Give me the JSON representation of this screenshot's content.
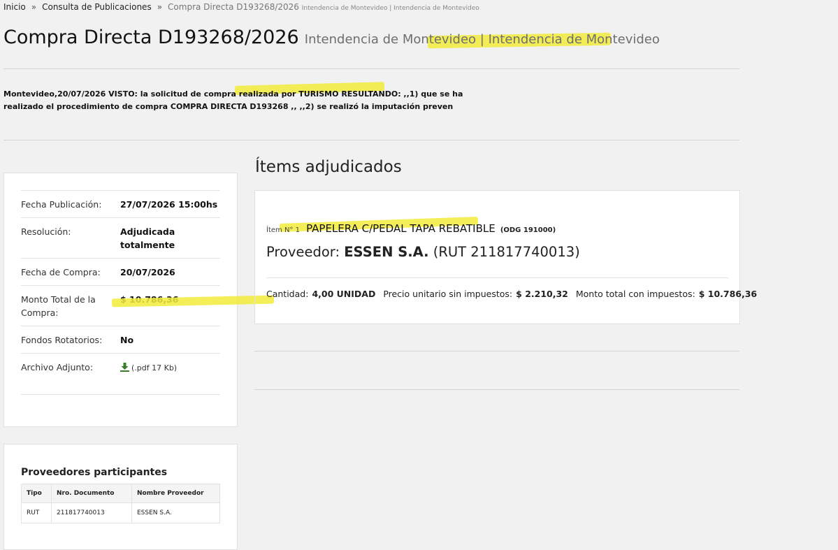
{
  "breadcrumb": {
    "home": "Inicio",
    "sep": "»",
    "section": "Consulta de Publicaciones",
    "current": "Compra Directa D193268/2026",
    "current_sub": "Intendencia de Montevideo | Intendencia de Montevideo"
  },
  "header": {
    "title": "Compra Directa D193268/2026",
    "subtitle": "Intendencia de Montevideo | Intendencia de Montevideo"
  },
  "summary": {
    "visto_text": "Montevideo,20/07/2026 VISTO: la solicitud de compra realizada por TURISMO RESULTANDO: ,,1) que se ha realizado el procedimiento de compra COMPRA DIRECTA D193268 ,, ,,2) se realizó la imputación preven"
  },
  "details": {
    "fecha_publicacion_label": "Fecha Publicación:",
    "fecha_publicacion_value": "27/07/2026 15:00hs",
    "resolucion_label": "Resolución:",
    "resolucion_value": "Adjudicada totalmente",
    "fecha_compra_label": "Fecha de Compra:",
    "fecha_compra_value": "20/07/2026",
    "monto_total_label": "Monto Total de la Compra:",
    "monto_total_value": "$ 10.786,36",
    "fondos_label": "Fondos Rotatorios:",
    "fondos_value": "No",
    "archivo_label": "Archivo Adjunto:",
    "archivo_value": "(.pdf 17 Kb)",
    "archivo_icon": "download-icon"
  },
  "items": {
    "title": "Ítems adjudicados",
    "item_number": "Ítem N° 1",
    "item_name": "PAPELERA C/PEDAL TAPA REBATIBLE",
    "item_code": "(ODG 191000)",
    "provider_label": "Proveedor:",
    "provider_name": "ESSEN S.A.",
    "provider_rut": "(RUT 211817740013)",
    "cantidad_label": "Cantidad:",
    "cantidad_value": "4,00 UNIDAD",
    "precio_label": "Precio unitario sin impuestos:",
    "precio_value": "$ 2.210,32",
    "monto_label": "Monto total con impuestos:",
    "monto_value": "$ 10.786,36"
  },
  "proveedores": {
    "title": "Proveedores participantes",
    "columns": [
      "Tipo",
      "Nro. Documento",
      "Nombre Proveedor"
    ],
    "rows": [
      [
        "RUT",
        "211817740013",
        "ESSEN S.A."
      ]
    ]
  },
  "colors": {
    "highlight": "#f2ec3c",
    "download_icon": "#3a7d2c"
  }
}
